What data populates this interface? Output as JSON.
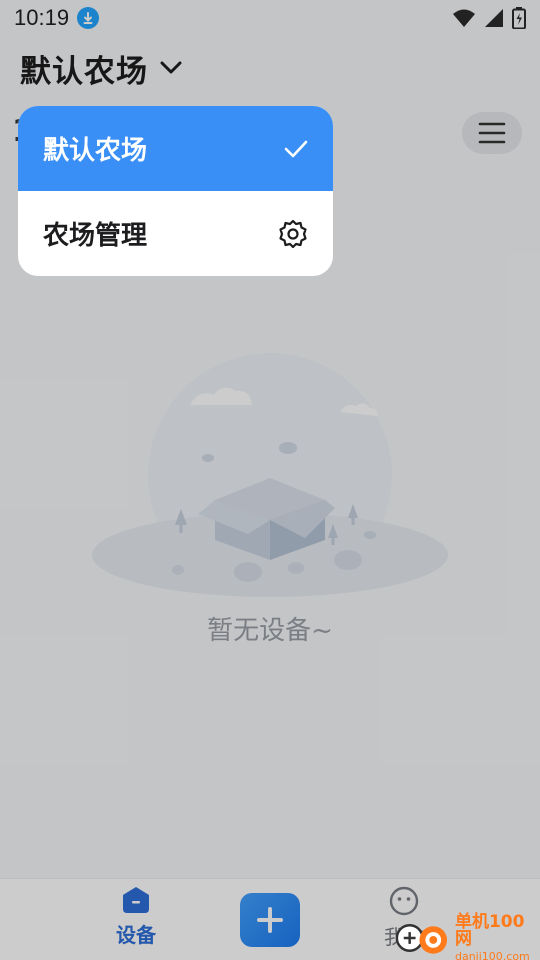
{
  "status_bar": {
    "time": "10:19",
    "icons": [
      "download-icon",
      "wifi-icon",
      "cell-signal-icon",
      "battery-icon"
    ]
  },
  "header": {
    "title": "默认农场",
    "partial_char": "1"
  },
  "main": {
    "empty_text": "暂无设备~"
  },
  "dropdown": {
    "items": [
      {
        "label": "默认农场",
        "icon": "check-icon",
        "selected": true
      },
      {
        "label": "农场管理",
        "icon": "gear-icon",
        "selected": false
      }
    ]
  },
  "bottom_nav": {
    "devices_label": "设备",
    "mine_label": "我的"
  },
  "watermark": {
    "text": "单机100网",
    "url": "danji100.com"
  },
  "colors": {
    "accent": "#3a8ff7",
    "nav_active": "#2d6fd8",
    "watermark": "#ff7a1a"
  }
}
